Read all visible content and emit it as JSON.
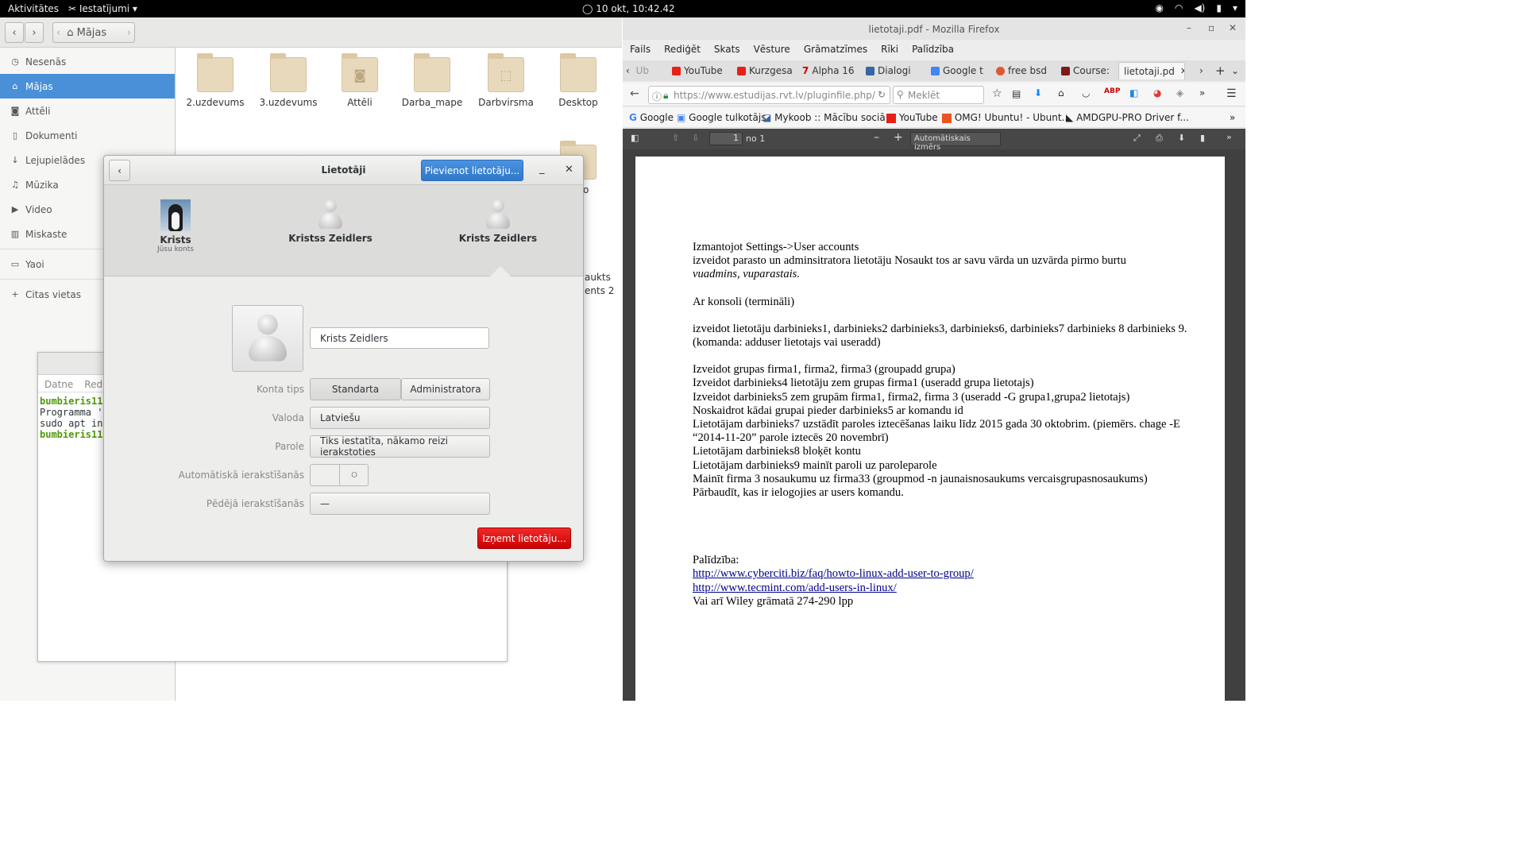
{
  "topbar": {
    "activities": "Aktivitātes",
    "app_menu": "Iestatījumi ▾",
    "clock": "10 okt, 10:42.42"
  },
  "nautilus": {
    "path_label": "Mājas",
    "sidebar": [
      "Nesenās",
      "Mājas",
      "Attēli",
      "Dokumenti",
      "Lejupielādes",
      "Mūzika",
      "Video",
      "Miskaste",
      "Yaoi",
      "Citas vietas"
    ],
    "folders": [
      "2.uzdevums",
      "3.uzdevums",
      "Attēli",
      "Darba_mape",
      "Darbvirsma",
      "Desktop"
    ],
    "partial_text": [
      "o",
      "aukts",
      "ents 2"
    ]
  },
  "terminal": {
    "menu": [
      "Datne",
      "Rediģ"
    ],
    "lines": [
      [
        "bumbieris11",
        ""
      ],
      [
        "",
        "Programma '"
      ],
      [
        "",
        "sudo apt in"
      ],
      [
        "bumbieris11",
        ""
      ]
    ]
  },
  "users_dialog": {
    "title": "Lietotāji",
    "add_button": "Pievienot lietotāju...",
    "users": [
      {
        "name": "Krists",
        "sub": "Jūsu konts"
      },
      {
        "name": "Kristss Zeidlers",
        "sub": ""
      },
      {
        "name": "Krists Zeidlers",
        "sub": ""
      }
    ],
    "name_value": "Krists Zeidlers",
    "labels": {
      "account_type": "Konta tips",
      "language": "Valoda",
      "password": "Parole",
      "autologin": "Automātiskā ierakstīšanās",
      "last_login": "Pēdējā ierakstīšanās"
    },
    "account_type_options": [
      "Standarta",
      "Administratora"
    ],
    "language_value": "Latviešu",
    "password_value": "Tiks iestatīta, nākamo reizi ierakstoties",
    "autologin_state": "O",
    "last_login_value": "—",
    "remove_button": "Izņemt lietotāju..."
  },
  "firefox": {
    "window_title": "lietotaji.pdf - Mozilla Firefox",
    "menu": [
      "Fails",
      "Rediģēt",
      "Skats",
      "Vēsture",
      "Grāmatzīmes",
      "Rīki",
      "Palīdzība"
    ],
    "tabs": [
      "Ub",
      "YouTube",
      "Kurzgesa",
      "Alpha 16",
      "Dialogi",
      "Google t",
      "free bsd",
      "Course:",
      "lietotaji.pd"
    ],
    "url": "https://www.estudijas.rvt.lv/pluginfile.php/",
    "search_placeholder": "Meklēt",
    "bookmarks": [
      "Google",
      "Google tulkotājs",
      "Mykoob :: Mācību sociā...",
      "YouTube",
      "OMG! Ubuntu! - Ubunt...",
      "AMDGPU-PRO Driver f..."
    ],
    "pdf": {
      "page_value": "1",
      "page_of": "no 1",
      "zoom": "Automātiskais izmērs"
    },
    "doc": {
      "l1": "Izmantojot Settings->User accounts",
      "l2": "izveidot parasto un adminsitratora lietotāju Nosaukt tos ar savu vārda un uzvārda pirmo burtu",
      "l3": "vuadmins, vuparastais.",
      "l4": "Ar konsoli (termināli)",
      "l5": "izveidot lietotāju darbinieks1, darbinieks2 darbinieks3, darbinieks6, darbinieks7 darbinieks 8 darbinieks 9.  (komanda: adduser lietotajs vai useradd)",
      "l6": "Izveidot grupas firma1, firma2, firma3 (groupadd grupa)",
      "l7": "Izveidot  darbinieks4 lietotāju zem grupas firma1 (useradd grupa lietotajs)",
      "l8": "Izveidot darbinieks5 zem grupām firma1, firma2, firma 3 (useradd -G grupa1,grupa2 lietotajs)",
      "l9": "Noskaidrot kādai grupai pieder darbinieks5  ar komandu id",
      "l10": "Lietotājam darbinieks7 uzstādīt paroles iztecēšanas laiku līdz 2015 gada 30 oktobrim. (piemērs. chage -E “2014-11-20” parole iztecēs 20 novembrī)",
      "l11": "Lietotājam darbinieks8 bloķēt kontu",
      "l12": "Lietotājam darbinieks9 mainīt paroli uz paroleparole",
      "l13": "Mainīt firma 3 nosaukumu uz firma33 (groupmod -n jaunaisnosaukums vercaisgrupasnosaukums)",
      "l14": "Pārbaudīt, kas ir ielogojies ar users komandu.",
      "help": "Palīdzība:",
      "link1": "http://www.cyberciti.biz/faq/howto-linux-add-user-to-group/",
      "link2": "http://www.tecmint.com/add-users-in-linux/",
      "last": "Vai arī Wiley grāmatā 274-290 lpp"
    }
  }
}
